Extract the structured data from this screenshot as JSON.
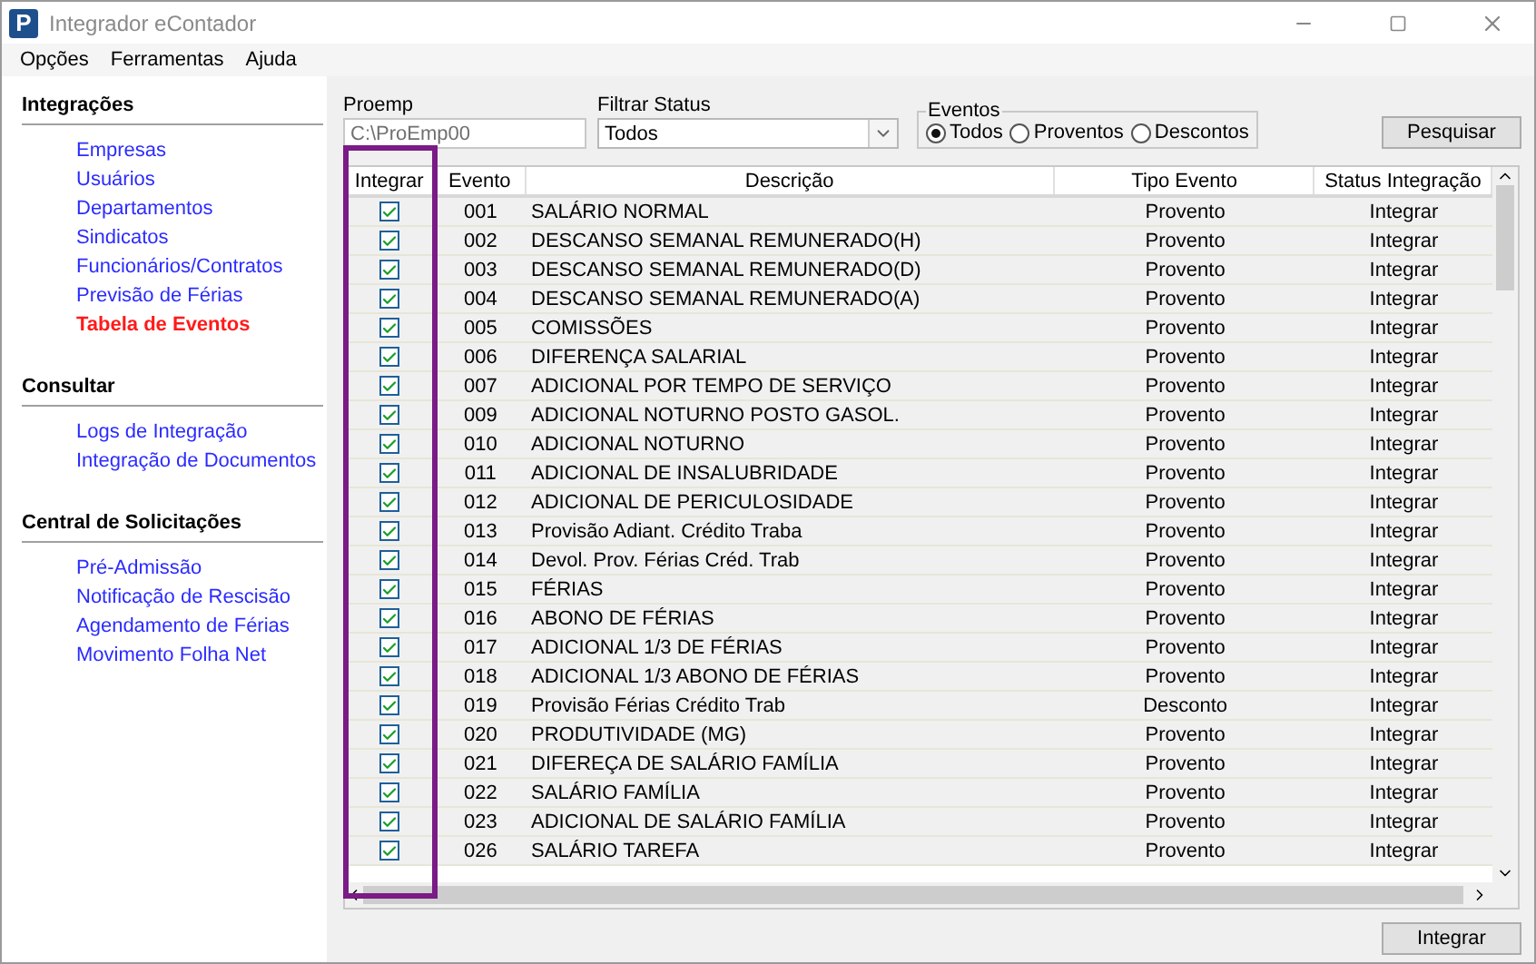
{
  "window": {
    "title": "Integrador eContador",
    "app_icon": "P"
  },
  "menu": [
    "Opções",
    "Ferramentas",
    "Ajuda"
  ],
  "sidebar": [
    {
      "title": "Integrações",
      "items": [
        {
          "label": "Empresas",
          "selected": false
        },
        {
          "label": "Usuários",
          "selected": false
        },
        {
          "label": "Departamentos",
          "selected": false
        },
        {
          "label": "Sindicatos",
          "selected": false
        },
        {
          "label": "Funcionários/Contratos",
          "selected": false
        },
        {
          "label": "Previsão de Férias",
          "selected": false
        },
        {
          "label": "Tabela de Eventos",
          "selected": true
        }
      ]
    },
    {
      "title": "Consultar",
      "items": [
        {
          "label": "Logs de Integração",
          "selected": false
        },
        {
          "label": "Integração de Documentos",
          "selected": false
        }
      ]
    },
    {
      "title": "Central de Solicitações",
      "items": [
        {
          "label": "Pré-Admissão",
          "selected": false
        },
        {
          "label": "Notificação de Rescisão",
          "selected": false
        },
        {
          "label": "Agendamento de Férias",
          "selected": false
        },
        {
          "label": "Movimento Folha Net",
          "selected": false
        }
      ]
    }
  ],
  "filters": {
    "proemp": {
      "label": "Proemp",
      "value": "C:\\ProEmp00"
    },
    "status": {
      "label": "Filtrar Status",
      "value": "Todos"
    },
    "eventos": {
      "label": "Eventos",
      "options": [
        {
          "label": "Todos",
          "selected": true
        },
        {
          "label": "Proventos",
          "selected": false
        },
        {
          "label": "Descontos",
          "selected": false
        }
      ]
    },
    "search_button": "Pesquisar"
  },
  "table": {
    "columns": [
      "Integrar",
      "Evento",
      "Descrição",
      "Tipo Evento",
      "Status Integração"
    ],
    "rows": [
      {
        "checked": true,
        "code": "001",
        "description": "SALÁRIO NORMAL",
        "type": "Provento",
        "status": "Integrar"
      },
      {
        "checked": true,
        "code": "002",
        "description": "DESCANSO SEMANAL REMUNERADO(H)",
        "type": "Provento",
        "status": "Integrar"
      },
      {
        "checked": true,
        "code": "003",
        "description": "DESCANSO SEMANAL REMUNERADO(D)",
        "type": "Provento",
        "status": "Integrar"
      },
      {
        "checked": true,
        "code": "004",
        "description": "DESCANSO SEMANAL REMUNERADO(A)",
        "type": "Provento",
        "status": "Integrar"
      },
      {
        "checked": true,
        "code": "005",
        "description": "COMISSÕES",
        "type": "Provento",
        "status": "Integrar"
      },
      {
        "checked": true,
        "code": "006",
        "description": "DIFERENÇA SALARIAL",
        "type": "Provento",
        "status": "Integrar"
      },
      {
        "checked": true,
        "code": "007",
        "description": "ADICIONAL POR TEMPO DE SERVIÇO",
        "type": "Provento",
        "status": "Integrar"
      },
      {
        "checked": true,
        "code": "009",
        "description": "ADICIONAL NOTURNO POSTO GASOL.",
        "type": "Provento",
        "status": "Integrar"
      },
      {
        "checked": true,
        "code": "010",
        "description": "ADICIONAL NOTURNO",
        "type": "Provento",
        "status": "Integrar"
      },
      {
        "checked": true,
        "code": "011",
        "description": "ADICIONAL DE INSALUBRIDADE",
        "type": "Provento",
        "status": "Integrar"
      },
      {
        "checked": true,
        "code": "012",
        "description": "ADICIONAL DE PERICULOSIDADE",
        "type": "Provento",
        "status": "Integrar"
      },
      {
        "checked": true,
        "code": "013",
        "description": "Provisão Adiant. Crédito Traba",
        "type": "Provento",
        "status": "Integrar"
      },
      {
        "checked": true,
        "code": "014",
        "description": "Devol. Prov. Férias Créd. Trab",
        "type": "Provento",
        "status": "Integrar"
      },
      {
        "checked": true,
        "code": "015",
        "description": "FÉRIAS",
        "type": "Provento",
        "status": "Integrar"
      },
      {
        "checked": true,
        "code": "016",
        "description": "ABONO DE FÉRIAS",
        "type": "Provento",
        "status": "Integrar"
      },
      {
        "checked": true,
        "code": "017",
        "description": "ADICIONAL 1/3 DE FÉRIAS",
        "type": "Provento",
        "status": "Integrar"
      },
      {
        "checked": true,
        "code": "018",
        "description": "ADICIONAL 1/3 ABONO DE FÉRIAS",
        "type": "Provento",
        "status": "Integrar"
      },
      {
        "checked": true,
        "code": "019",
        "description": "Provisão Férias Crédito Trab",
        "type": "Desconto",
        "status": "Integrar"
      },
      {
        "checked": true,
        "code": "020",
        "description": "PRODUTIVIDADE (MG)",
        "type": "Provento",
        "status": "Integrar"
      },
      {
        "checked": true,
        "code": "021",
        "description": "DIFEREÇA DE SALÁRIO FAMÍLIA",
        "type": "Provento",
        "status": "Integrar"
      },
      {
        "checked": true,
        "code": "022",
        "description": "SALÁRIO FAMÍLIA",
        "type": "Provento",
        "status": "Integrar"
      },
      {
        "checked": true,
        "code": "023",
        "description": "ADICIONAL DE SALÁRIO FAMÍLIA",
        "type": "Provento",
        "status": "Integrar"
      },
      {
        "checked": true,
        "code": "026",
        "description": "SALÁRIO TAREFA",
        "type": "Provento",
        "status": "Integrar"
      }
    ]
  },
  "integrate_button": "Integrar"
}
